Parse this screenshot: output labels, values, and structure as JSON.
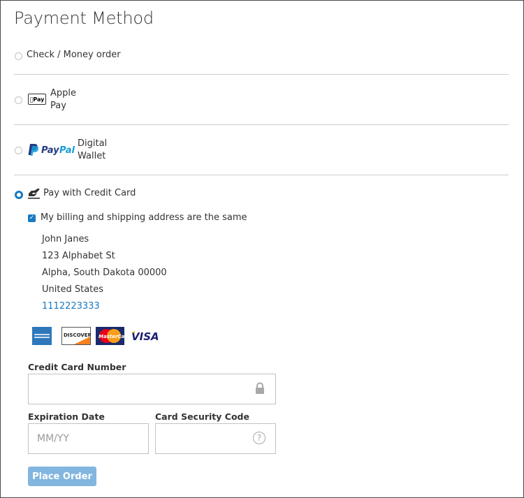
{
  "page": {
    "title": "Payment Method"
  },
  "payment_options": [
    {
      "id": "checkmo",
      "label": "Check / Money order",
      "selected": false
    },
    {
      "id": "applepay",
      "logo_text": "Pay",
      "label_line1": "Apple",
      "label_line2": "Pay",
      "selected": false
    },
    {
      "id": "paypal",
      "logo_text": "PayPal",
      "label_line1": "Digital",
      "label_line2": "Wallet",
      "selected": false
    },
    {
      "id": "creditcard",
      "label": "Pay with Credit Card",
      "selected": true
    }
  ],
  "billing": {
    "same_address_label": "My billing and shipping address are the same",
    "same_address_checked": true,
    "name": "John Janes",
    "street": "123 Alphabet St",
    "city_state_zip": "Alpha, South Dakota 00000",
    "country": "United States",
    "phone": "1112223333"
  },
  "card_types": [
    {
      "name": "amex",
      "label": "AMERICAN EXPRESS"
    },
    {
      "name": "discover",
      "label": "DISCOVER"
    },
    {
      "name": "mastercard",
      "label": "MasterCard"
    },
    {
      "name": "visa",
      "label": "VISA"
    }
  ],
  "form": {
    "card_number_label": "Credit Card Number",
    "card_number_value": "",
    "expiration_label": "Expiration Date",
    "expiration_placeholder": "MM/YY",
    "security_code_label": "Card Security Code",
    "security_code_value": "",
    "help_glyph": "?"
  },
  "actions": {
    "place_order_label": "Place Order"
  },
  "colors": {
    "accent": "#1979c3",
    "button_disabled": "#82b6e0",
    "paypal_dark": "#253b80",
    "paypal_light": "#179bd7"
  }
}
